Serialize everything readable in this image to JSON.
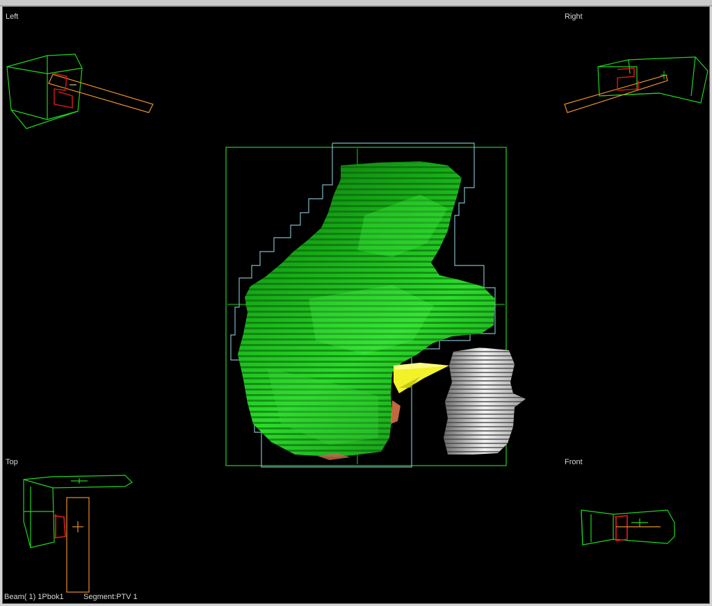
{
  "viewport": {
    "label_left": "Left",
    "label_right": "Right",
    "label_top": "Top",
    "label_front": "Front"
  },
  "status": {
    "beam": "Beam( 1) 1Pbok1",
    "segment": "Segment:PTV 1"
  },
  "colors": {
    "background": "#000000",
    "wireframe": "#1fd51f",
    "beam_field": "#e8902c",
    "structure_red": "#d01818",
    "ptv_green": "#27d627",
    "mlc_outline": "#7fb8c4",
    "organ_yellow": "#f2f22a",
    "organ_white": "#dcdcdc"
  }
}
